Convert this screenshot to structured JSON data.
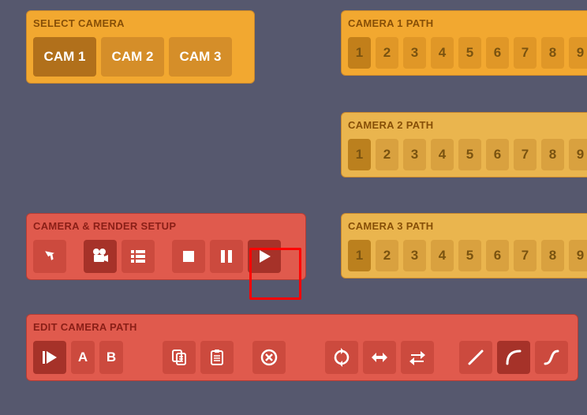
{
  "select_camera": {
    "title": "SELECT CAMERA",
    "buttons": [
      "CAM 1",
      "CAM 2",
      "CAM 3"
    ],
    "active_index": 0
  },
  "camera_paths": [
    {
      "title": "CAMERA 1 PATH",
      "numbers": [
        "1",
        "2",
        "3",
        "4",
        "5",
        "6",
        "7",
        "8",
        "9"
      ],
      "active_index": 0
    },
    {
      "title": "CAMERA 2 PATH",
      "numbers": [
        "1",
        "2",
        "3",
        "4",
        "5",
        "6",
        "7",
        "8",
        "9"
      ],
      "active_index": 0
    },
    {
      "title": "CAMERA 3 PATH",
      "numbers": [
        "1",
        "2",
        "3",
        "4",
        "5",
        "6",
        "7",
        "8",
        "9"
      ],
      "active_index": 0
    }
  ],
  "render_setup": {
    "title": "CAMERA & RENDER SETUP"
  },
  "edit_path": {
    "title": "EDIT CAMERA PATH",
    "a_label": "A",
    "b_label": "B"
  }
}
